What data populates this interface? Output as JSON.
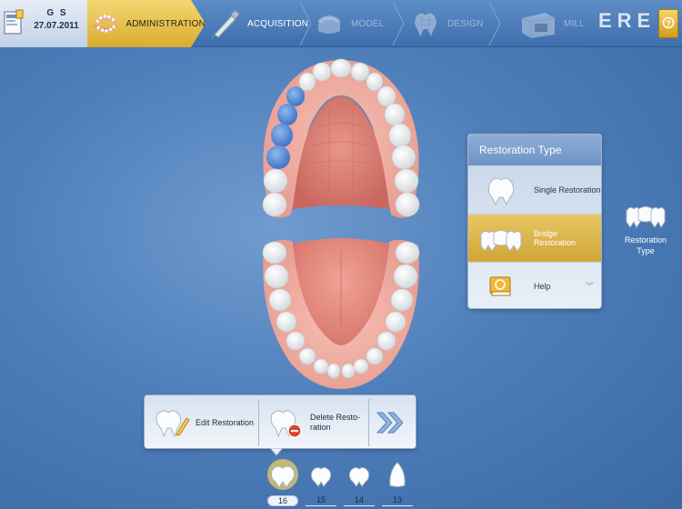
{
  "patient": {
    "initials": "G S",
    "date": "27.07.2011"
  },
  "workflow": {
    "steps": [
      {
        "label": "ADMINISTRATION",
        "state": "active"
      },
      {
        "label": "ACQUISITION",
        "state": "enabled"
      },
      {
        "label": "MODEL",
        "state": "disabled"
      },
      {
        "label": "DESIGN",
        "state": "disabled"
      },
      {
        "label": "MILL",
        "state": "disabled"
      }
    ]
  },
  "brand": {
    "text": "ERE"
  },
  "restoration_panel": {
    "title": "Restoration Type",
    "items": [
      {
        "label": "Single Restoration",
        "selected": false
      },
      {
        "label": "Bridge Restoration",
        "selected": true
      },
      {
        "label": "Help",
        "selected": false
      }
    ]
  },
  "restoration_type_side": {
    "line1": "Restoration",
    "line2": "Type"
  },
  "toolbar": {
    "edit_label": "Edit Restoration",
    "delete_label_line1": "Delete Resto-",
    "delete_label_line2": "ration"
  },
  "tooth_strip": [
    {
      "number": "16",
      "selected": true
    },
    {
      "number": "15",
      "selected": false
    },
    {
      "number": "14",
      "selected": false
    },
    {
      "number": "13",
      "selected": false
    }
  ],
  "colors": {
    "accent_gold": "#d9ac2f",
    "selected_teeth": "#4f86d6",
    "background_blue": "#4f7fba"
  }
}
